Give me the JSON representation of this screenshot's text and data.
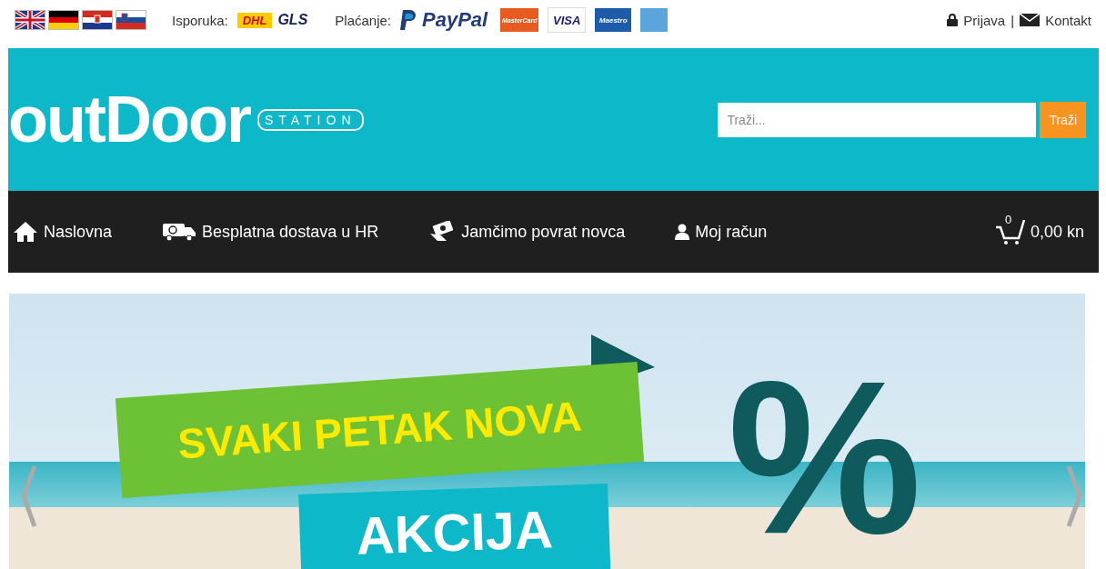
{
  "topbar": {
    "delivery_label": "Isporuka:",
    "carriers": [
      {
        "kind": "dhl",
        "text": "DHL"
      },
      {
        "kind": "gls",
        "text": "GLS"
      }
    ],
    "payment_label": "Plaćanje:",
    "payments": [
      {
        "kind": "paypal",
        "text": "PayPal"
      },
      {
        "kind": "mastercard",
        "text": "MasterCard"
      },
      {
        "kind": "visa",
        "text": "VISA"
      },
      {
        "kind": "maestro",
        "text": "Maestro"
      },
      {
        "kind": "amex"
      }
    ],
    "login": "Prijava",
    "separator": "|",
    "contact": "Kontakt"
  },
  "logo": {
    "word": "outDoor",
    "sub": "STATION"
  },
  "search": {
    "placeholder": "Traži...",
    "button": "Traži"
  },
  "nav": [
    {
      "kind": "home",
      "label": "Naslovna"
    },
    {
      "kind": "truck",
      "label": "Besplatna dostava u HR"
    },
    {
      "kind": "money",
      "label": "Jamčimo povrat novca"
    },
    {
      "kind": "user",
      "label": "Moj račun"
    }
  ],
  "cart": {
    "count": "0",
    "total": "0,00 kn"
  },
  "banner": {
    "line1": "SVAKI PETAK NOVA",
    "line2": "AKCIJA",
    "sign": "%"
  }
}
